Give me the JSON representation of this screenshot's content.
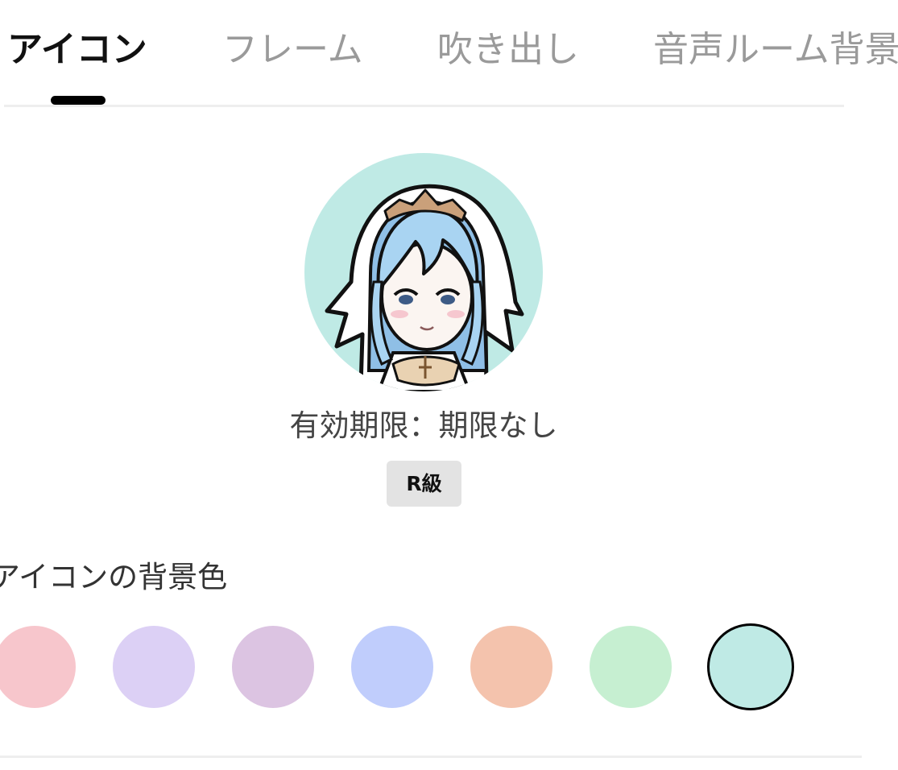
{
  "tabs": [
    {
      "label": "アイコン",
      "active": true
    },
    {
      "label": "フレーム",
      "active": false
    },
    {
      "label": "吹き出し",
      "active": false
    },
    {
      "label": "音声ルーム背景",
      "active": false
    }
  ],
  "item": {
    "expiry_text": "有効期限：期限なし",
    "rank_label": "R級"
  },
  "background_section": {
    "label": "アイコンの背景色",
    "selected_index": 6,
    "swatches": [
      {
        "color": "#f7c6cc"
      },
      {
        "color": "#dcd0f5"
      },
      {
        "color": "#dcc4e2"
      },
      {
        "color": "#c0cdfc"
      },
      {
        "color": "#f4c3ad"
      },
      {
        "color": "#c6efd1"
      },
      {
        "color": "#bfeae5"
      }
    ]
  },
  "colors": {
    "active_tab": "#111111",
    "inactive_tab": "#9a9a9a",
    "indicator": "#000000",
    "avatar_background": "#bfeae5"
  }
}
